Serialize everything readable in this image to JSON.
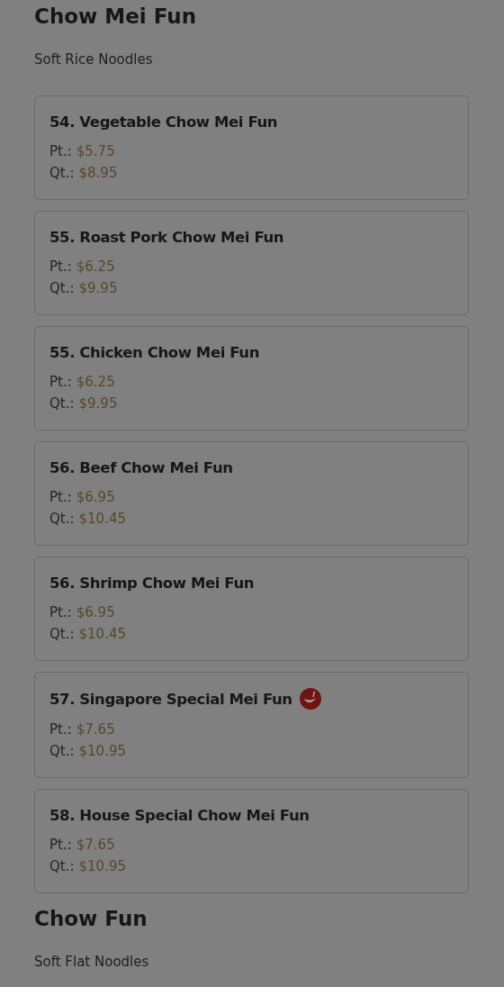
{
  "sections": [
    {
      "title": "Chow Mei Fun",
      "subtitle": "Soft Rice Noodles",
      "items": [
        {
          "name": "54. Vegetable Chow Mei Fun",
          "spicy": false,
          "prices": [
            {
              "label": "Pt.:",
              "price": "$5.75"
            },
            {
              "label": "Qt.:",
              "price": "$8.95"
            }
          ]
        },
        {
          "name": "55. Roast Pork Chow Mei Fun",
          "spicy": false,
          "prices": [
            {
              "label": "Pt.:",
              "price": "$6.25"
            },
            {
              "label": "Qt.:",
              "price": "$9.95"
            }
          ]
        },
        {
          "name": "55. Chicken Chow Mei Fun",
          "spicy": false,
          "prices": [
            {
              "label": "Pt.:",
              "price": "$6.25"
            },
            {
              "label": "Qt.:",
              "price": "$9.95"
            }
          ]
        },
        {
          "name": "56. Beef Chow Mei Fun",
          "spicy": false,
          "prices": [
            {
              "label": "Pt.:",
              "price": "$6.95"
            },
            {
              "label": "Qt.:",
              "price": "$10.45"
            }
          ]
        },
        {
          "name": "56. Shrimp Chow Mei Fun",
          "spicy": false,
          "prices": [
            {
              "label": "Pt.:",
              "price": "$6.95"
            },
            {
              "label": "Qt.:",
              "price": "$10.45"
            }
          ]
        },
        {
          "name": "57. Singapore Special Mei Fun",
          "spicy": true,
          "prices": [
            {
              "label": "Pt.:",
              "price": "$7.65"
            },
            {
              "label": "Qt.:",
              "price": "$10.95"
            }
          ]
        },
        {
          "name": "58. House Special Chow Mei Fun",
          "spicy": false,
          "prices": [
            {
              "label": "Pt.:",
              "price": "$7.65"
            },
            {
              "label": "Qt.:",
              "price": "$10.95"
            }
          ]
        }
      ]
    },
    {
      "title": "Chow Fun",
      "subtitle": "Soft Flat Noodles"
    }
  ]
}
